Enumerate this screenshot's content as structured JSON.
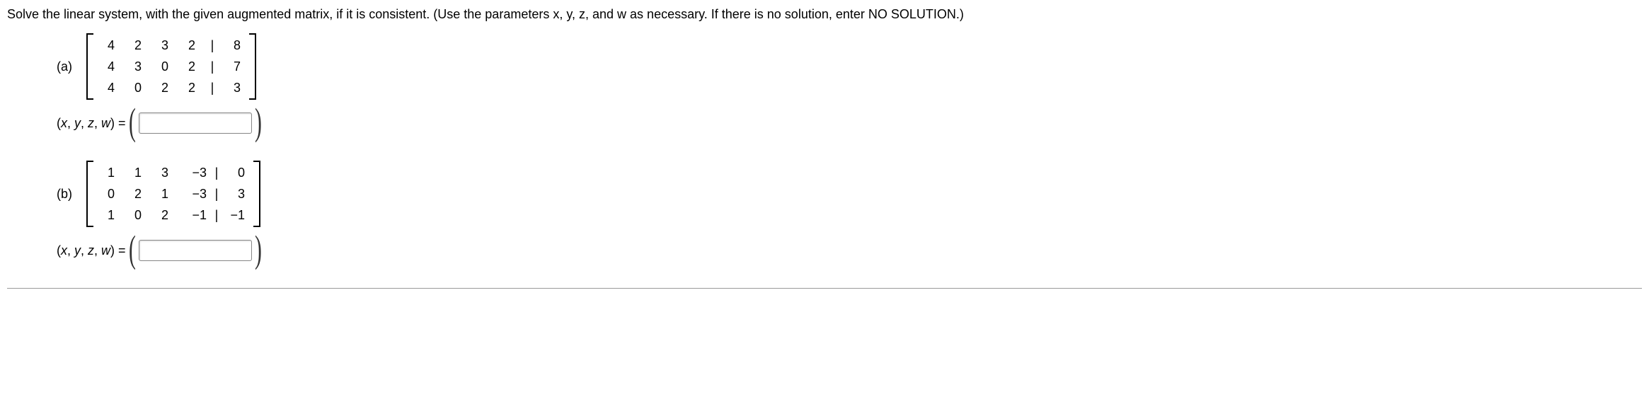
{
  "question": "Solve the linear system, with the given augmented matrix, if it is consistent. (Use the parameters x, y, z, and w as necessary. If there is no solution, enter NO SOLUTION.)",
  "parts": {
    "a": {
      "label": "(a)",
      "matrix": {
        "rows": [
          {
            "c1": "4",
            "c2": "2",
            "c3": "3",
            "c4": "2",
            "aug": "8"
          },
          {
            "c1": "4",
            "c2": "3",
            "c3": "0",
            "c4": "2",
            "aug": "7"
          },
          {
            "c1": "4",
            "c2": "0",
            "c3": "2",
            "c4": "2",
            "aug": "3"
          }
        ],
        "sep": "|"
      },
      "answer_label": "(x, y, z, w) = ",
      "input_value": ""
    },
    "b": {
      "label": "(b)",
      "matrix": {
        "rows": [
          {
            "c1": "1",
            "c2": "1",
            "c3": "3",
            "c4": "−3",
            "aug": "0"
          },
          {
            "c1": "0",
            "c2": "2",
            "c3": "1",
            "c4": "−3",
            "aug": "3"
          },
          {
            "c1": "1",
            "c2": "0",
            "c3": "2",
            "c4": "−1",
            "aug": "−1"
          }
        ],
        "sep": "|"
      },
      "answer_label": "(x, y, z, w) = ",
      "input_value": ""
    }
  }
}
